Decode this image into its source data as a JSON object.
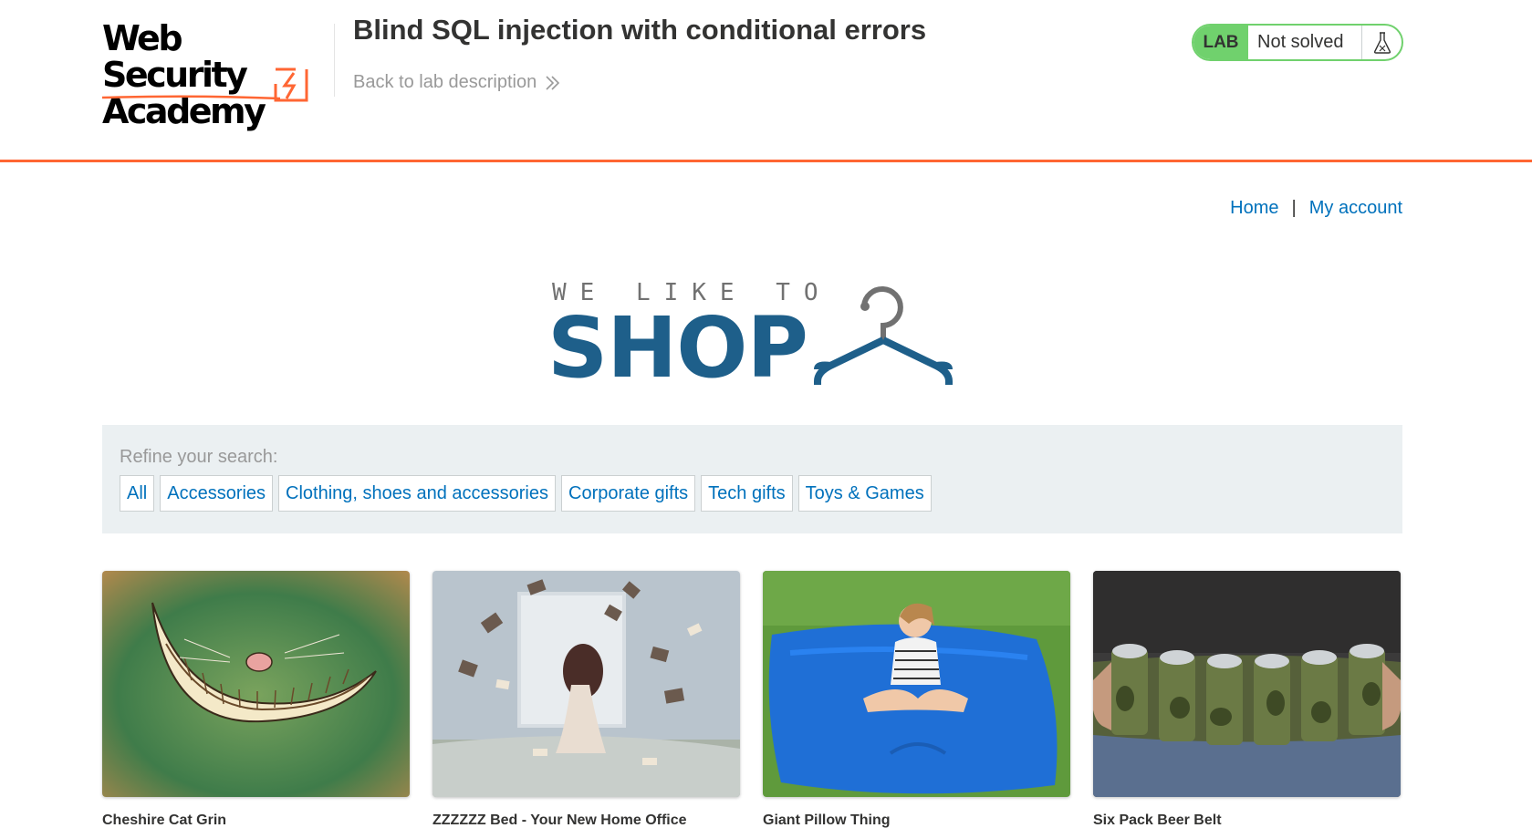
{
  "header": {
    "logo_line1": "Web Security",
    "logo_line2": "Academy",
    "lab_title": "Blind SQL injection with conditional errors",
    "back_link": "Back to lab description",
    "lab_badge": "LAB",
    "lab_status": "Not solved",
    "colors": {
      "accent": "#ff6633",
      "solved_green": "#70d16d",
      "link": "#0071bc"
    }
  },
  "nav": {
    "home": "Home",
    "separator": "|",
    "my_account": "My account"
  },
  "banner": {
    "line1": "WE LIKE TO",
    "line2": "SHOP",
    "icon": "hanger-icon",
    "color": "#1e5f8a"
  },
  "filters": {
    "label": "Refine your search:",
    "items": [
      "All",
      "Accessories",
      "Clothing, shoes and accessories",
      "Corporate gifts",
      "Tech gifts",
      "Toys & Games"
    ]
  },
  "products": [
    {
      "name": "Cheshire Cat Grin",
      "image": "cheshire-cat-grin"
    },
    {
      "name": "ZZZZZZ Bed - Your New Home Office",
      "image": "floating-books-bed"
    },
    {
      "name": "Giant Pillow Thing",
      "image": "blue-giant-pillow"
    },
    {
      "name": "Six Pack Beer Belt",
      "image": "camo-beer-belt"
    }
  ]
}
